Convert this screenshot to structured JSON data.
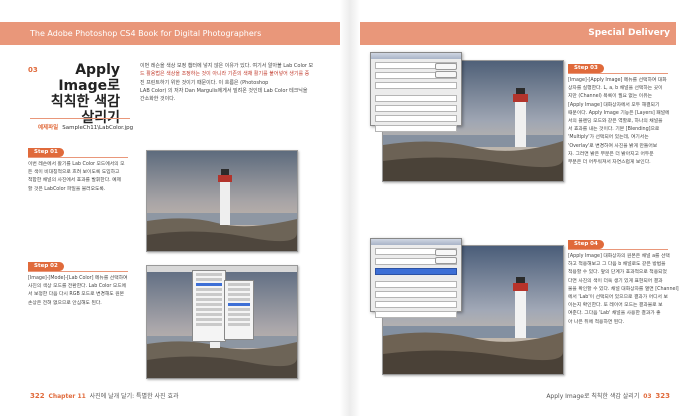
{
  "left_page": {
    "header": "The Adobe Photoshop CS4 Book for Digital Photographers",
    "section_number": "03",
    "title_lines": [
      "Apply Image로",
      "칙칙한 색감",
      "살리기"
    ],
    "sample_label": "예제파일",
    "sample_file": "SampleCh11\\LabColor.jpg",
    "intro_lines": [
      "이번 레슨을 색상 보정 챕터에 넣지 않은 이유가 있다. 여기서 알아볼 Lab Color 모",
      "드 활용법은 색상을 조정하는 것이 아니라 기존의 색채 활기를 불어넣어 생기를 증",
      "진 프린트하기 위한 것이기 때문이다. 이 흐름은 (Photoshop",
      "LAB Color) 의 저자 Dan Margulis에게서 빌려온 것인데 Lab Color 테크닉을",
      "간소화한 것이다."
    ],
    "step1": {
      "label": "Step 01",
      "lines": [
        "이번 레슨에서 활기를 Lab Color 모드에서의 모",
        "든 색이 비대칭적으로 흐려 보이도록 도입하고",
        "적합한 채널의 사진에서 효과를 발휘한다. 예제",
        "할 것은 LabColor 파일을 불러오도록."
      ]
    },
    "step2": {
      "label": "Step 02",
      "lines": [
        "[Image]-[Mode]-[Lab Color] 메뉴를 선택하여",
        "사진의 색상 모드를 전환한다. Lab Color 모드에",
        "서 보정한 다음 다시 RGB 모드로 변경해도 원본",
        "손상은 전혀 없으므로 안심해도 된다."
      ]
    },
    "footer": {
      "page_number": "322",
      "chapter": "Chapter 11",
      "text": "사진에 날개 달기: 특별한 사진 효과"
    }
  },
  "right_page": {
    "header": "Special Delivery",
    "step3": {
      "label": "Step 03",
      "lines": [
        "[Image]-[Apply Image] 메뉴를 선택하여 대화",
        "상자를 실행한다. L, a, b 채널을 선택하는 곳이",
        "지만 (Channel) 목록이 필요 없는 이유는",
        "[Apply Image] 대화상자에서 모두 해결되기",
        "때문이다. Apply Image 기능은 [Layers] 패널에",
        "서의 블렌딩 모드와 같은 역할로, 하나의 채널을",
        "서 효과를 내는 것이다. 기본 [Blending]으로",
        "'Multiply'가 선택되어 있는데, 여기서는",
        "'Overlay'로 변경하여 사진을 밝게 만들어보",
        "자. 그러면 밝은 부분은 더 밝아지고 어두운",
        "부분은 더 어두워져서 자연스럽게 보인다."
      ]
    },
    "step4": {
      "label": "Step 04",
      "lines": [
        "[Apply Image] 대화상자의 원본은 채널 a를 선택",
        "하고 적용해보고 그 다음 b 채널로도 같은 방법을",
        "적용할 수 있다. 앞의 단계가 효과적으로 적용되었",
        "다면 사진의 색이 더욱 생기 있게 표현되어 결과",
        "물을 확인할 수 있다. 채널 대화상자를 열면 [Channel]",
        "에서 'Lab'이 선택되어 있으므로 결과가 어디서 보",
        "이는지 확인한다. 또 레이어 모드는 결과물로 보",
        "여준다. 그다음 'Lab' 채널을 사용한 결과가 좋",
        "아 나은 뒤에 적용하면 된다."
      ]
    },
    "footer": {
      "text": "Apply Image로 칙칙한 색감 살리기",
      "section": "03",
      "page_number": "323"
    }
  },
  "colors": {
    "accent": "#e06a3b",
    "header_band": "#e9977a"
  }
}
